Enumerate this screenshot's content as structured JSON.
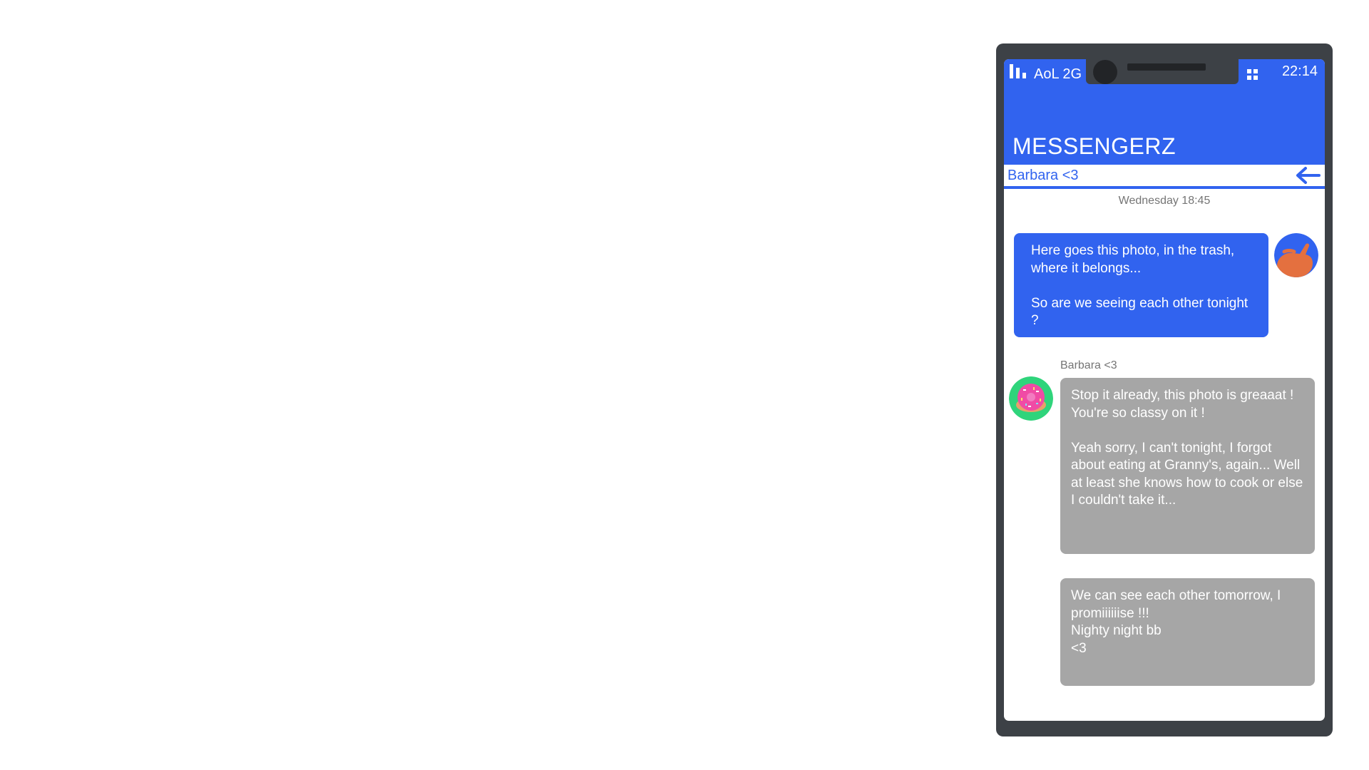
{
  "status_bar": {
    "carrier": "AoL 2G",
    "time": "22:14"
  },
  "app": {
    "title": "MESSENGERZ"
  },
  "conversation": {
    "contact_name": "Barbara <3",
    "datestamp": "Wednesday 18:45"
  },
  "messages": [
    {
      "direction": "outgoing",
      "lines": [
        "Here goes this photo, in the trash, where it belongs...",
        "",
        "So are we seeing each other tonight ?"
      ]
    },
    {
      "direction": "incoming",
      "sender": "Barbara <3",
      "lines": [
        "Stop it already, this photo is greaaat ! You're so classy on it !",
        "",
        "Yeah sorry, I can't tonight, I forgot about eating at Granny's, again... Well at least she knows how to cook or else I couldn't take it..."
      ]
    },
    {
      "direction": "incoming",
      "lines": [
        "We can see each other tomorrow, I promiiiiiise !!!",
        "Nighty night bb",
        "<3"
      ]
    }
  ],
  "icons": {
    "signal": "signal-bars-icon",
    "apps": "grid-icon",
    "back": "arrow-left-icon",
    "avatar_me": "hand-icon",
    "avatar_barbara": "donut-icon"
  },
  "colors": {
    "accent": "#3163ef",
    "phone_frame": "#3d4146",
    "incoming_bubble": "#a6a6a6",
    "muted_text": "#757575",
    "avatar_me_bg": "#3163ef",
    "avatar_me_hand": "#e4703f",
    "avatar_barbara_bg": "#2fd47b",
    "avatar_barbara_donut": "#f04ba5"
  }
}
